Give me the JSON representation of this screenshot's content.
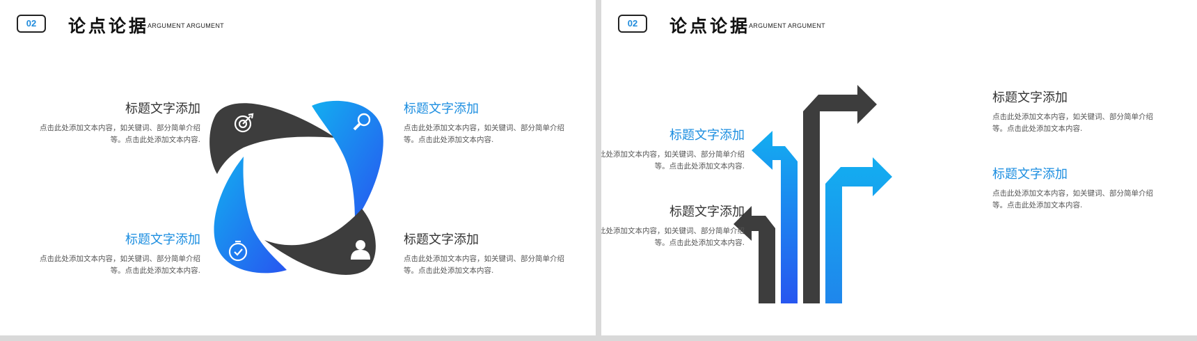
{
  "colors": {
    "blue_light": "#13aef0",
    "blue_dark": "#2756f0",
    "gray": "#3d3d3d",
    "blue_title": "#1c8ee0"
  },
  "left_slide": {
    "badge": "02",
    "title": "论点论据",
    "subtitle": "ARGUMENT ARGUMENT",
    "items": [
      {
        "title": "标题文字添加",
        "desc": "点击此处添加文本内容，如关键词、部分简单介绍等。点击此处添加文本内容.",
        "icon": "target-icon"
      },
      {
        "title": "标题文字添加",
        "desc": "点击此处添加文本内容，如关键词、部分简单介绍等。点击此处添加文本内容.",
        "icon": "magnifier-icon"
      },
      {
        "title": "标题文字添加",
        "desc": "点击此处添加文本内容，如关键词、部分简单介绍等。点击此处添加文本内容.",
        "icon": "stopwatch-icon"
      },
      {
        "title": "标题文字添加",
        "desc": "点击此处添加文本内容，如关键词、部分简单介绍等。点击此处添加文本内容.",
        "icon": "person-icon"
      }
    ]
  },
  "right_slide": {
    "badge": "02",
    "title": "论点论据",
    "subtitle": "ARGUMENT ARGUMENT",
    "items": [
      {
        "title": "标题文字添加",
        "desc": "点击此处添加文本内容，如关键词、部分简单介绍等。点击此处添加文本内容."
      },
      {
        "title": "标题文字添加",
        "desc": "点击此处添加文本内容，如关键词、部分简单介绍等。点击此处添加文本内容."
      },
      {
        "title": "标题文字添加",
        "desc": "点击此处添加文本内容，如关键词、部分简单介绍等。点击此处添加文本内容."
      },
      {
        "title": "标题文字添加",
        "desc": "点击此处添加文本内容，如关键词、部分简单介绍等。点击此处添加文本内容."
      }
    ]
  }
}
